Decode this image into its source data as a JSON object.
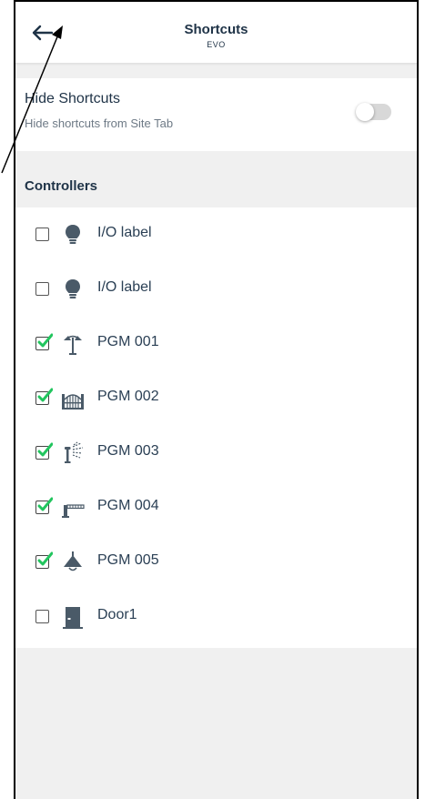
{
  "header": {
    "title": "Shortcuts",
    "subtitle": "EVO"
  },
  "hide_shortcuts": {
    "title": "Hide Shortcuts",
    "description": "Hide shortcuts from Site Tab",
    "enabled": false
  },
  "controllers": {
    "title": "Controllers",
    "items": [
      {
        "label": "I/O label",
        "checked": false,
        "icon": "light-bulb-icon"
      },
      {
        "label": "I/O label",
        "checked": false,
        "icon": "light-bulb-icon"
      },
      {
        "label": "PGM 001",
        "checked": true,
        "icon": "garden-light-icon"
      },
      {
        "label": "PGM 002",
        "checked": true,
        "icon": "gate-icon"
      },
      {
        "label": "PGM 003",
        "checked": true,
        "icon": "sprinkler-icon"
      },
      {
        "label": "PGM 004",
        "checked": true,
        "icon": "barrier-icon"
      },
      {
        "label": "PGM 005",
        "checked": true,
        "icon": "pendant-lamp-icon"
      },
      {
        "label": "Door1",
        "checked": false,
        "icon": "door-icon"
      }
    ]
  },
  "colors": {
    "accent": "#1f3347",
    "check": "#22c55e",
    "background": "#f0f0f0"
  }
}
